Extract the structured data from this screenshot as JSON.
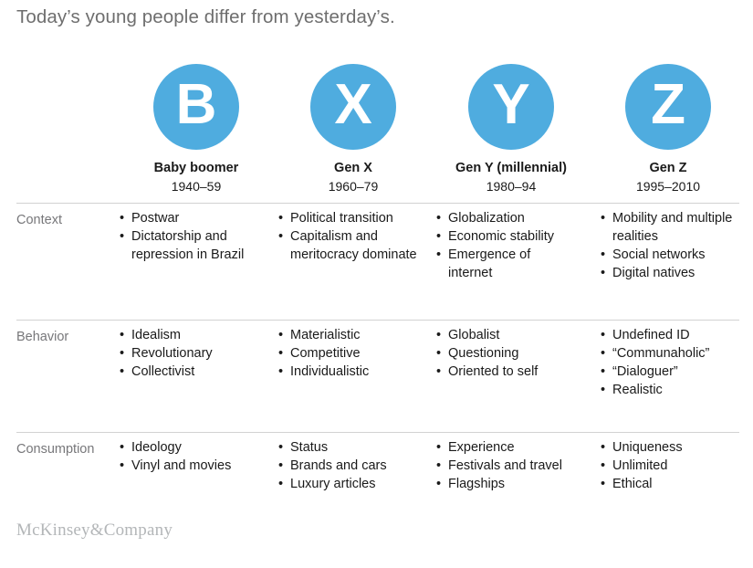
{
  "title": "Today’s young people differ from yesterday’s.",
  "accent_color": "#4facdf",
  "divider_color": "#d2d2d2",
  "label_color": "#77777a",
  "logo": "McKinsey&Company",
  "generations": [
    {
      "initial": "B",
      "name": "Baby boomer",
      "years": "1940–59"
    },
    {
      "initial": "X",
      "name": "Gen X",
      "years": "1960–79"
    },
    {
      "initial": "Y",
      "name": "Gen Y (millennial)",
      "years": "1980–94"
    },
    {
      "initial": "Z",
      "name": "Gen Z",
      "years": "1995–2010"
    }
  ],
  "rows": [
    {
      "label": "Context",
      "cells": [
        [
          "Postwar",
          "Dictatorship and repression in Brazil"
        ],
        [
          "Political transition",
          "Capitalism and meritocracy dominate"
        ],
        [
          "Globalization",
          "Economic stability",
          "Emergence of internet"
        ],
        [
          "Mobility and multiple realities",
          "Social networks",
          "Digital natives"
        ]
      ]
    },
    {
      "label": "Behavior",
      "cells": [
        [
          "Idealism",
          "Revolutionary",
          "Collectivist"
        ],
        [
          "Materialistic",
          "Competitive",
          "Individualistic"
        ],
        [
          "Globalist",
          "Questioning",
          "Oriented to self"
        ],
        [
          "Undefined ID",
          "“Communaholic”",
          "“Dialoguer”",
          "Realistic"
        ]
      ]
    },
    {
      "label": "Consumption",
      "cells": [
        [
          "Ideology",
          "Vinyl and movies"
        ],
        [
          "Status",
          "Brands and cars",
          "Luxury articles"
        ],
        [
          "Experience",
          "Festivals and travel",
          "Flagships"
        ],
        [
          "Uniqueness",
          "Unlimited",
          "Ethical"
        ]
      ]
    }
  ]
}
